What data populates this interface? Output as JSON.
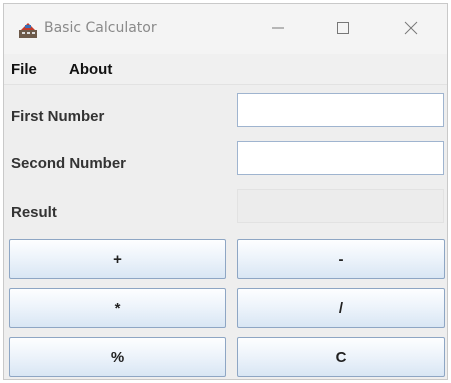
{
  "window": {
    "title": "Basic Calculator",
    "app_icon": "calculator-app-icon",
    "controls": {
      "minimize_icon": "minimize-icon",
      "maximize_icon": "maximize-icon",
      "close_icon": "close-icon"
    }
  },
  "menubar": {
    "items": [
      {
        "label": "File"
      },
      {
        "label": "About"
      }
    ]
  },
  "form": {
    "first_label": "First Number",
    "first_value": "",
    "second_label": "Second Number",
    "second_value": "",
    "result_label": "Result",
    "result_value": ""
  },
  "buttons": {
    "add": "+",
    "subtract": "-",
    "multiply": "*",
    "divide": "/",
    "modulo": "%",
    "clear": "C"
  },
  "colors": {
    "button_border": "#8ea6c4",
    "button_gradient_top": "#fdfeff",
    "button_gradient_bottom": "#d9e6f4",
    "window_bg": "#eeeeee"
  }
}
